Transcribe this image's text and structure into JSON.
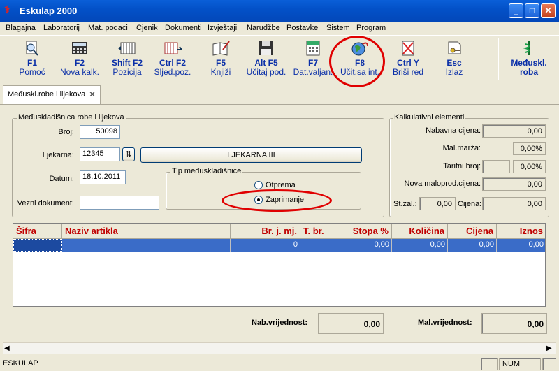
{
  "window": {
    "title": "Eskulap 2000"
  },
  "menu": [
    "Blagajna",
    "Laboratorij",
    "Mat. podaci",
    "Cjenik",
    "Dokumenti",
    "Izvještaji",
    "Narudžbe",
    "Postavke",
    "Sistem",
    "Program"
  ],
  "toolbar": [
    {
      "key": "F1",
      "label": "Pomoć",
      "icon": "help-icon"
    },
    {
      "key": "F2",
      "label": "Nova kalk.",
      "icon": "calculator-icon"
    },
    {
      "key": "Shift F2",
      "label": "Pozicija",
      "icon": "position-icon"
    },
    {
      "key": "Ctrl F2",
      "label": "Sljed.poz.",
      "icon": "next-position-icon"
    },
    {
      "key": "F5",
      "label": "Knjiži",
      "icon": "book-icon"
    },
    {
      "key": "Alt F5",
      "label": "Učitaj pod.",
      "icon": "floppy-icon"
    },
    {
      "key": "F7",
      "label": "Dat.valjan.",
      "icon": "calendar-icon"
    },
    {
      "key": "F8",
      "label": "Učit.sa int.",
      "icon": "globe-icon"
    },
    {
      "key": "Ctrl Y",
      "label": "Briši red",
      "icon": "delete-row-icon"
    },
    {
      "key": "Esc",
      "label": "Izlaz",
      "icon": "exit-key-icon"
    }
  ],
  "module": {
    "label_line1": "Međuskl.",
    "label_line2": "roba"
  },
  "tab": {
    "label": "Međuskl.robe i lijekova"
  },
  "form": {
    "group_title": "Međuskladišnica robe i lijekova",
    "broj_label": "Broj:",
    "broj": "50098",
    "ljekarna_label": "Ljekarna:",
    "ljekarna": "12345",
    "ljekarna_name": "LJEKARNA III",
    "datum_label": "Datum:",
    "datum": "18.10.2011",
    "vezni_label": "Vezni dokument:",
    "vezni": "",
    "tip_title": "Tip međuskladišnice",
    "opt1": "Otprema",
    "opt2": "Zaprimanje",
    "selected": "Zaprimanje"
  },
  "calc": {
    "group_title": "Kalkulativni elementi",
    "nabavna_label": "Nabavna cijena:",
    "nabavna": "0,00",
    "marza_label": "Mal.marža:",
    "marza": "0,00%",
    "tarifni_label": "Tarifni broj:",
    "tarifni": "",
    "tarifni_pct": "0,00%",
    "nova_label": "Nova maloprod.cijena:",
    "nova": "0,00",
    "stzal_label": "St.zal.:",
    "stzal": "0,00",
    "cijena_label": "Cijena:",
    "cijena": "0,00"
  },
  "grid": {
    "headers": [
      "Šifra",
      "Naziv artikla",
      "Br. j. mj.",
      "T. br.",
      "Stopa %",
      "Količina",
      "Cijena",
      "Iznos"
    ],
    "row": {
      "sifra": "",
      "naziv": "",
      "brj": "0",
      "tbr": "",
      "stopa": "0,00",
      "kolicina": "0,00",
      "cijena": "0,00",
      "iznos": "0,00"
    }
  },
  "totals": {
    "nab_label": "Nab.vrijednost:",
    "nab": "0,00",
    "mal_label": "Mal.vrijednost:",
    "mal": "0,00"
  },
  "status": {
    "app": "ESKULAP",
    "num": "NUM"
  },
  "accent": "#0a2fa8",
  "header_color": "#c00000",
  "highlight_color": "#e00000"
}
